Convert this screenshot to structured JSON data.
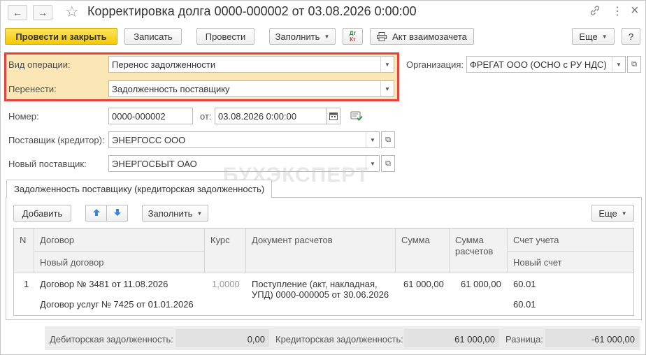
{
  "window": {
    "title": "Корректировка долга 0000-000002 от 03.08.2026 0:00:00"
  },
  "titlebar": {
    "back": "←",
    "forward": "→",
    "star": "☆",
    "link": "🔗",
    "more": "⋮",
    "close": "×"
  },
  "toolbar": {
    "post_close": "Провести и закрыть",
    "save": "Записать",
    "post": "Провести",
    "fill": "Заполнить",
    "dtkt_top": "Дт",
    "dtkt_bottom": "Кт",
    "act": "Акт взаимозачета",
    "more": "Еще",
    "help": "?"
  },
  "form": {
    "operation_label": "Вид операции:",
    "operation_value": "Перенос задолженности",
    "transfer_label": "Перенести:",
    "transfer_value": "Задолженность поставщику",
    "org_label": "Организация:",
    "org_value": "ФРЕГАТ ООО (ОСНО с РУ НДС)",
    "number_label": "Номер:",
    "number_value": "0000-000002",
    "date_label": "от:",
    "date_value": "03.08.2026  0:00:00",
    "supplier_label": "Поставщик (кредитор):",
    "supplier_value": "ЭНЕРГОСС ООО",
    "new_supplier_label": "Новый поставщик:",
    "new_supplier_value": "ЭНЕРГОСБЫТ ОАО"
  },
  "tab": {
    "label": "Задолженность поставщику (кредиторская задолженность)"
  },
  "table_toolbar": {
    "add": "Добавить",
    "fill": "Заполнить",
    "more": "Еще"
  },
  "table": {
    "headers": {
      "n": "N",
      "contract": "Договор",
      "new_contract": "Новый договор",
      "rate": "Курс",
      "doc": "Документ расчетов",
      "sum": "Сумма",
      "sum_calc_1": "Сумма",
      "sum_calc_2": "расчетов",
      "account": "Счет учета",
      "new_account": "Новый счет"
    },
    "rows": [
      {
        "n": "1",
        "contract": "Договор № 3481 от 11.08.2026",
        "new_contract": "Договор услуг № 7425 от 01.01.2026",
        "rate": "1,0000",
        "doc_1": "Поступление (акт, накладная,",
        "doc_2": "УПД) 0000-000005 от 30.06.2026",
        "sum": "61 000,00",
        "sum_calc": "61 000,00",
        "account": "60.01",
        "new_account": "60.01"
      }
    ]
  },
  "footer": {
    "debit_label": "Дебиторская задолженность:",
    "debit_value": "0,00",
    "credit_label": "Кредиторская задолженность:",
    "credit_value": "61 000,00",
    "diff_label": "Разница:",
    "diff_value": "-61 000,00"
  },
  "watermark": "БУХЭКСПЕРТ",
  "colors": {
    "primary_button": "#f5c900",
    "highlight_border": "#e8413b",
    "highlight_fill": "#fbe7b6"
  }
}
